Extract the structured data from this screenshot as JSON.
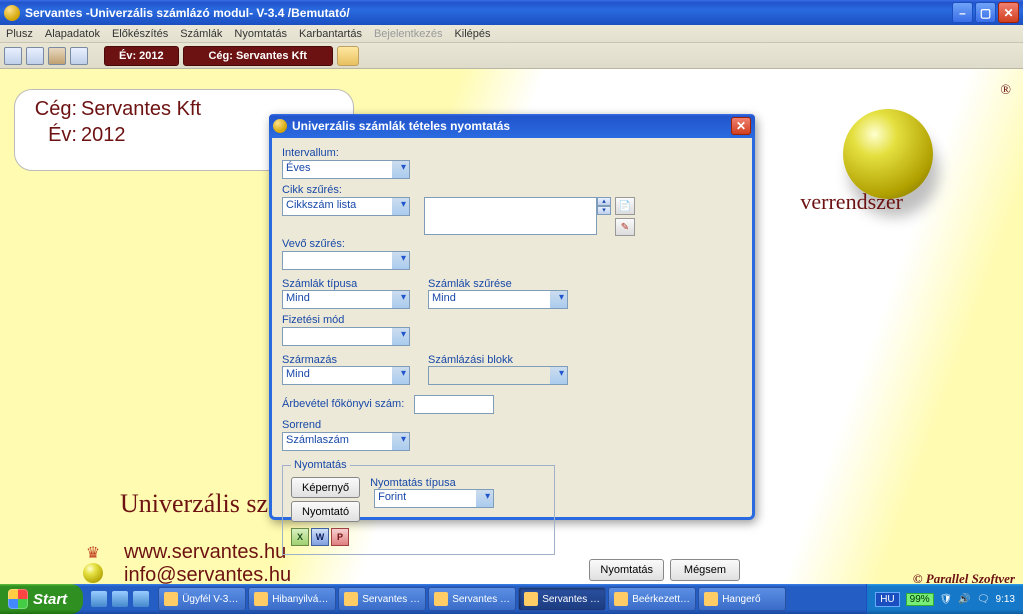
{
  "window": {
    "title": "Servantes -Univerzális számlázó modul- V-3.4 /Bemutató/"
  },
  "menu": {
    "items": [
      "Plusz",
      "Alapadatok",
      "Előkészítés",
      "Számlák",
      "Nyomtatás",
      "Karbantartás",
      "Bejelentkezés",
      "Kilépés"
    ],
    "disabled_index": 6
  },
  "toolbar": {
    "year_label": "Év: 2012",
    "company_label": "Cég: Servantes Kft"
  },
  "card": {
    "company_label": "Cég:",
    "company_value": "Servantes Kft",
    "year_label": "Év:",
    "year_value": "2012"
  },
  "brand": {
    "slogan_suffix": "verrendszer",
    "uni_prefix": "Univerzális sz",
    "web": "www.servantes.hu",
    "email": "info@servantes.hu",
    "copyright": "© Parallel Szoftver"
  },
  "dialog": {
    "title": "Univerzális számlák tételes nyomtatás",
    "intervallum_label": "Intervallum:",
    "intervallum_value": "Éves",
    "cikk_label": "Cikk szűrés:",
    "cikk_value": "Cikkszám lista",
    "vevo_label": "Vevő szűrés:",
    "tipus_label": "Számlák típusa",
    "tipus_value": "Mind",
    "szures_label": "Számlák szűrése",
    "szures_value": "Mind",
    "fizmod_label": "Fizetési mód",
    "szarmazas_label": "Származás",
    "szarmazas_value": "Mind",
    "blokk_label": "Számlázási blokk",
    "arbevetel_label": "Árbevétel főkönyvi szám:",
    "sorrend_label": "Sorrend",
    "sorrend_value": "Számlaszám",
    "nyomtatas_legend": "Nyomtatás",
    "kepernyo_btn": "Képernyő",
    "nyomtato_btn": "Nyomtató",
    "nytipus_label": "Nyomtatás típusa",
    "nytipus_value": "Forint",
    "ok_btn": "Nyomtatás",
    "cancel_btn": "Mégsem"
  },
  "taskbar": {
    "start": "Start",
    "tasks": [
      "Ügyfél V-3…",
      "Hibanyilvá…",
      "Servantes …",
      "Servantes …",
      "Servantes …",
      "Beérkezett…",
      "Hangerő"
    ],
    "active_index": 4,
    "lang": "HU",
    "battery": "99%",
    "clock": "9:13"
  }
}
